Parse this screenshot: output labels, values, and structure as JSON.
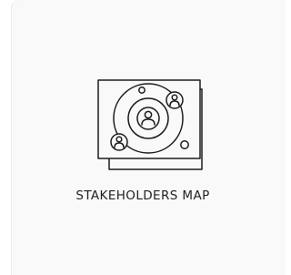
{
  "card": {
    "icon": "stakeholders-map-icon",
    "title": "STAKEHOLDERS MAP"
  },
  "colors": {
    "background": "#ffffff",
    "card": "#f9f9fa",
    "stroke": "#1c1c1c",
    "text": "#222222"
  }
}
